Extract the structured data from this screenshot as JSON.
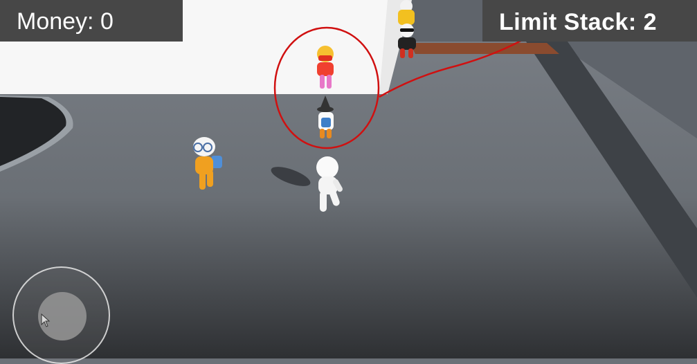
{
  "hud": {
    "money_label": "Money: 0",
    "limit_stack_label": "Limit Stack: 2"
  },
  "icons": [
    "cursor-arrow-icon"
  ],
  "colors": {
    "hud_background": "#474747",
    "annotation_red": "#d01010",
    "floor": "#6b7077",
    "platform": "#ffffff"
  }
}
